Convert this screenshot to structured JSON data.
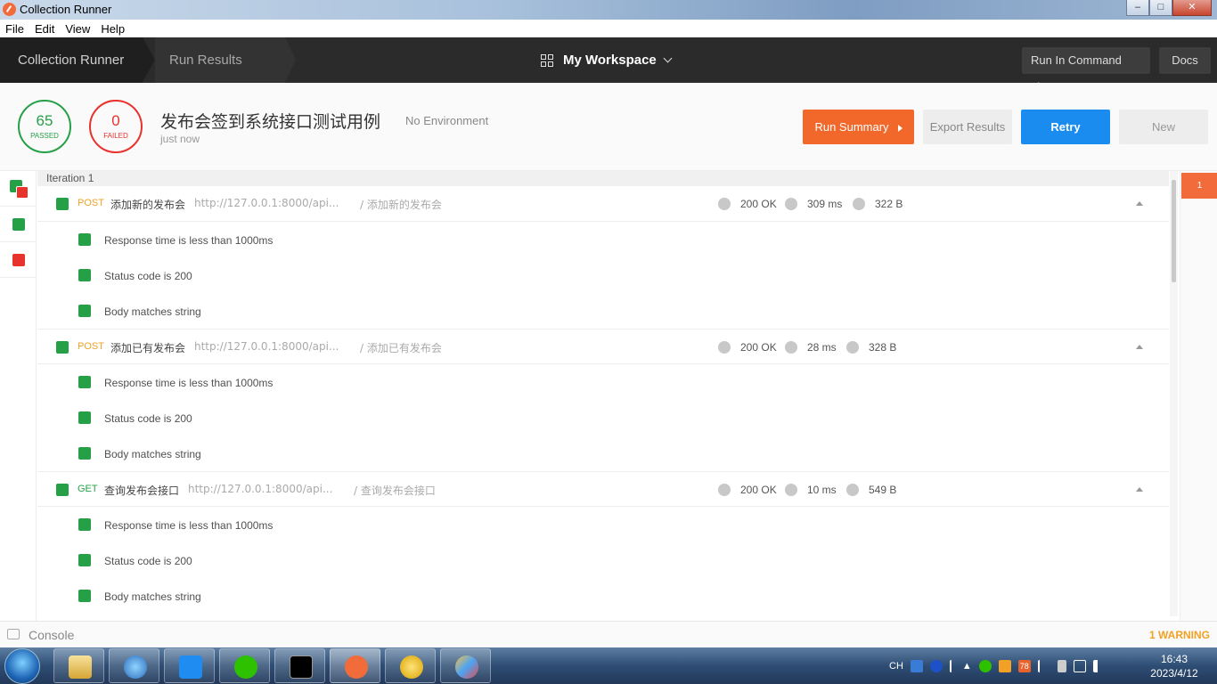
{
  "window": {
    "title": "Collection Runner"
  },
  "menu": [
    "File",
    "Edit",
    "View",
    "Help"
  ],
  "header": {
    "crumb1": "Collection Runner",
    "crumb2": "Run Results",
    "workspace": "My Workspace",
    "cmdline": "Run In Command Line",
    "docs": "Docs"
  },
  "summary": {
    "passed": "65",
    "passed_label": "PASSED",
    "failed": "0",
    "failed_label": "FAILED",
    "name": "发布会签到系统接口测试用例",
    "environment": "No Environment",
    "time": "just now",
    "run_summary": "Run Summary",
    "export": "Export Results",
    "retry": "Retry",
    "new": "New"
  },
  "iteration": "Iteration 1",
  "requests": [
    {
      "method": "POST",
      "name": "添加新的发布会",
      "url": "http://127.0.0.1:8000/api...",
      "path": "/ 添加新的发布会",
      "status": "200 OK",
      "time": "309 ms",
      "size": "322 B",
      "tests": [
        "Response time is less than 1000ms",
        "Status code is 200",
        "Body matches string"
      ]
    },
    {
      "method": "POST",
      "name": "添加已有发布会",
      "url": "http://127.0.0.1:8000/api...",
      "path": "/ 添加已有发布会",
      "status": "200 OK",
      "time": "28 ms",
      "size": "328 B",
      "tests": [
        "Response time is less than 1000ms",
        "Status code is 200",
        "Body matches string"
      ]
    },
    {
      "method": "GET",
      "name": "查询发布会接口",
      "url": "http://127.0.0.1:8000/api...",
      "path": "/ 查询发布会接口",
      "status": "200 OK",
      "time": "10 ms",
      "size": "549 B",
      "tests": [
        "Response time is less than 1000ms",
        "Status code is 200",
        "Body matches string"
      ]
    }
  ],
  "right_badge": "1",
  "console": {
    "label": "Console",
    "warning": "1 WARNING"
  },
  "taskbar": {
    "lang": "CH",
    "tray_badge": "78",
    "time": "16:43",
    "date": "2023/4/12"
  },
  "colors": {
    "pass": "#26a047",
    "fail": "#e8322c",
    "accent": "#f2672a",
    "retry": "#1a8cf0",
    "post": "#f2a126"
  }
}
